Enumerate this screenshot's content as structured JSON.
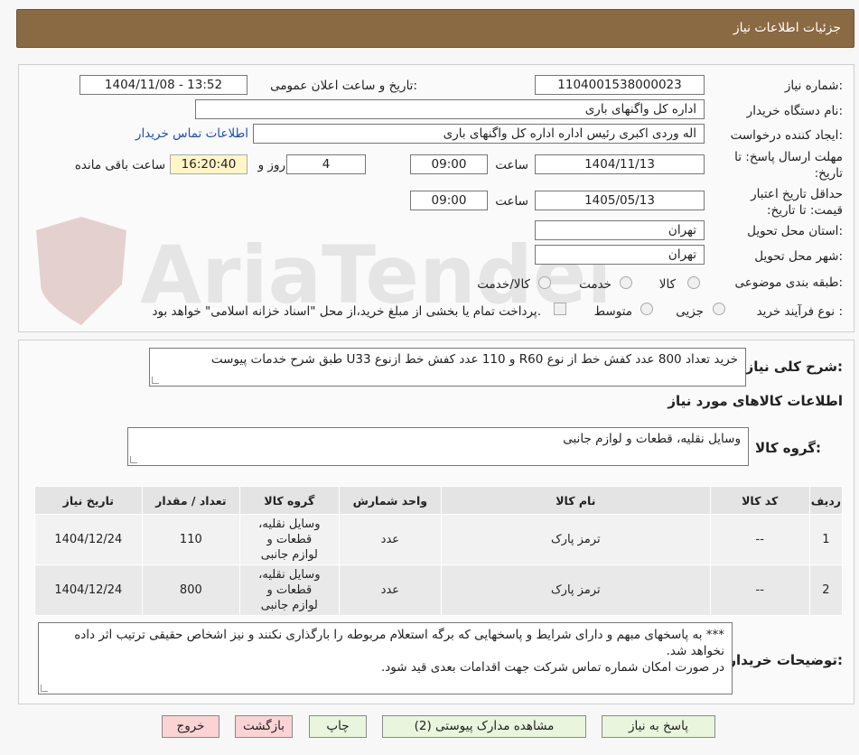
{
  "title": "جزئیات اطلاعات نیاز",
  "watermark_text": "AriaTender.neT",
  "fields": {
    "need_number_label": "شماره نیاز:",
    "need_number": "1104001538000023",
    "announce_label": "تاریخ و ساعت اعلان عمومی:",
    "announce_value": "1404/11/08 - 13:52",
    "buyer_org_label": "نام دستگاه خریدار:",
    "buyer_org": "اداره کل واگنهای باری",
    "creator_label": "ایجاد کننده درخواست:",
    "creator": "اله وردی اکبری رئیس اداره  اداره کل واگنهای باری",
    "contact_link": "اطلاعات تماس خریدار",
    "deadline_label": "مهلت ارسال پاسخ: تا تاریخ:",
    "deadline_date": "1404/11/13",
    "time_label": "ساعت",
    "deadline_time": "09:00",
    "days_value": "4",
    "days_label": "روز و",
    "remaining_time": "16:20:40",
    "remaining_label": "ساعت باقی مانده",
    "validity_label": "حداقل تاریخ اعتبار قیمت: تا تاریخ:",
    "validity_date": "1405/05/13",
    "validity_time": "09:00",
    "province_label": "استان محل تحویل:",
    "province": "تهران",
    "city_label": "شهر محل تحویل:",
    "city": "تهران",
    "category_label": "طبقه بندی موضوعی:",
    "category_options": [
      "کالا",
      "خدمت",
      "کالا/خدمت"
    ],
    "process_label": "نوع فرآیند خرید :",
    "process_options": [
      "جزیی",
      "متوسط"
    ],
    "payment_note": "پرداخت تمام یا بخشی از مبلغ خرید،از محل \"اسناد خزانه اسلامی\" خواهد بود."
  },
  "summary": {
    "label": "شرح کلی نیاز:",
    "text": "خرید تعداد 800 عدد کفش خط از نوع R60 و 110 عدد کفش خط ازنوع U33 طبق شرح خدمات پیوست"
  },
  "goods_heading": "اطلاعات کالاهای مورد نیاز",
  "goods_group": {
    "label": "گروه کالا:",
    "value": "وسایل نقلیه، قطعات و لوازم جانبی"
  },
  "table": {
    "headers": [
      "ردیف",
      "کد کالا",
      "نام کالا",
      "واحد شمارش",
      "گروه کالا",
      "تعداد / مقدار",
      "تاریخ نیاز"
    ],
    "rows": [
      [
        "1",
        "--",
        "ترمز پارک",
        "عدد",
        "وسایل نقلیه، قطعات و لوازم جانبی",
        "110",
        "1404/12/24"
      ],
      [
        "2",
        "--",
        "ترمز پارک",
        "عدد",
        "وسایل نقلیه، قطعات و لوازم جانبی",
        "800",
        "1404/12/24"
      ]
    ]
  },
  "buyer_notes": {
    "label": "توضیحات خریدار:",
    "lines": [
      "***  به پاسخهای مبهم و دارای شرایط و پاسخهایی که برگه استعلام مربوطه را بارگذاری نکنند و نیز اشخاص حقیقی ترتیب اثر داده نخواهد شد.",
      "در صورت امکان شماره تماس شرکت جهت اقدامات بعدی قید شود."
    ]
  },
  "buttons": {
    "reply": "پاسخ به نیاز",
    "attachments": "مشاهده مدارک پیوستی (2)",
    "print": "چاپ",
    "back": "بازگشت",
    "exit": "خروج"
  },
  "colors": {
    "title_bg": "#8a6a42",
    "link": "#1a4fb8",
    "highlight": "#fff6c8",
    "button_green": "#e9f5dc",
    "button_red": "#fbd3d3"
  }
}
